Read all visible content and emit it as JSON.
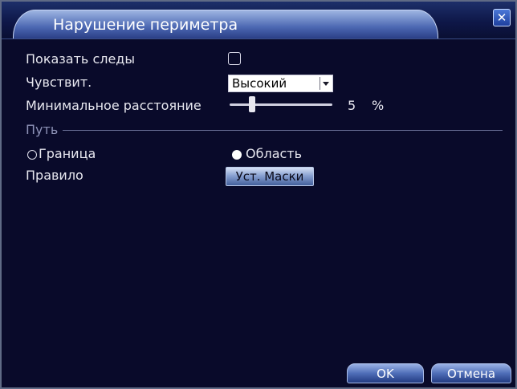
{
  "window": {
    "title": "Нарушение периметра",
    "close_glyph": "✕"
  },
  "fields": {
    "show_traces_label": "Показать следы",
    "show_traces_checked": false,
    "sensitivity_label": "Чувствит.",
    "sensitivity_value": "Высокий",
    "min_distance_label": "Минимальное расстояние",
    "min_distance_value": "5",
    "min_distance_unit": "%",
    "min_distance_level": 0.2
  },
  "path": {
    "section_label": "Путь",
    "options": [
      {
        "label": "Граница",
        "selected": false
      },
      {
        "label": "Область",
        "selected": true
      }
    ]
  },
  "rule": {
    "label": "Правило",
    "button_label": "Уст. Маски"
  },
  "footer": {
    "ok_label": "OK",
    "cancel_label": "Отмена"
  },
  "icons": {
    "close": "close-icon",
    "dropdown": "chevron-down-icon"
  },
  "colors": {
    "background": "#090a2a",
    "accent": "#4b67b2",
    "text": "#e8e8f0"
  }
}
